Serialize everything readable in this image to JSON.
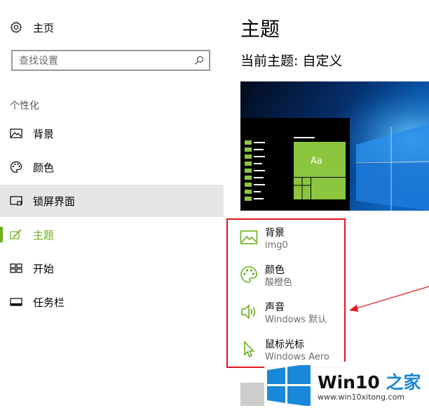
{
  "sidebar": {
    "home_label": "主页",
    "search_placeholder": "查找设置",
    "section_title": "个性化",
    "items": [
      {
        "label": "背景",
        "icon": "picture-icon"
      },
      {
        "label": "颜色",
        "icon": "palette-icon"
      },
      {
        "label": "锁屏界面",
        "icon": "lock-screen-icon"
      },
      {
        "label": "主题",
        "icon": "theme-brush-icon"
      },
      {
        "label": "开始",
        "icon": "start-grid-icon"
      },
      {
        "label": "任务栏",
        "icon": "taskbar-icon"
      }
    ],
    "hovered_item": "锁屏界面",
    "selected_item": "主题"
  },
  "main": {
    "title": "主题",
    "current_theme": "当前主题: 自定义",
    "preview": {
      "tile_label": "Aa"
    },
    "theme_options": [
      {
        "title": "背景",
        "value": "img0",
        "icon": "picture-icon"
      },
      {
        "title": "颜色",
        "value": "酸橙色",
        "icon": "palette-icon"
      },
      {
        "title": "声音",
        "value": "Windows 默认",
        "icon": "speaker-icon"
      },
      {
        "title": "鼠标光标",
        "value": "Windows Aero",
        "icon": "cursor-icon"
      }
    ]
  },
  "watermark": {
    "title_prefix": "Win10",
    "title_suffix": " 之家",
    "url": "www.win10xitong.com"
  },
  "colors": {
    "accent": "#6dad1e",
    "tile_green": "#8cc63f",
    "highlight_border": "#e2151b",
    "hover_bg": "#e6e6e6",
    "windows_blue": "#1a88d8"
  }
}
